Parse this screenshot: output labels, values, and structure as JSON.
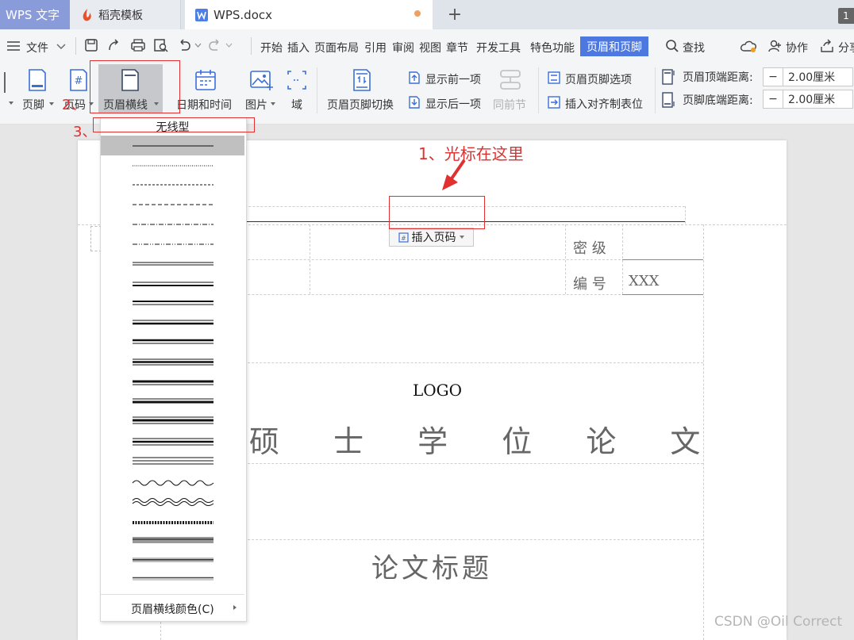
{
  "tabs": {
    "app": "WPS 文字",
    "template": "稻壳模板",
    "document": "WPS.docx",
    "add": "+",
    "count": "1"
  },
  "menu": {
    "file": "文件",
    "items": [
      "开始",
      "插入",
      "页面布局",
      "引用",
      "审阅",
      "视图",
      "章节",
      "开发工具",
      "特色功能"
    ],
    "active": "页眉和页脚",
    "search": "查找",
    "collab": "协作",
    "share": "分享"
  },
  "ribbon": {
    "footer": "页脚",
    "page_number": "页码",
    "header_line": "页眉横线",
    "date_time": "日期和时间",
    "picture": "图片",
    "field": "域",
    "switch": "页眉页脚切换",
    "show_prev": "显示前一项",
    "show_next": "显示后一项",
    "same_prev": "同前节",
    "options": "页眉页脚选项",
    "insert_tab": "插入对齐制表位",
    "header_top_label": "页眉顶端距离:",
    "header_top_value": "2.00厘米",
    "footer_bottom_label": "页脚底端距离:",
    "footer_bottom_value": "2.00厘米",
    "minus": "−"
  },
  "annotations": {
    "step1": "1、光标在这里",
    "step2": "2、",
    "step3": "3、"
  },
  "dropdown": {
    "none_option": "无线型",
    "color_option": "页眉横线颜色(C)"
  },
  "document": {
    "insert_page_number": "插入页码",
    "secret_label": "密 级",
    "number_label": "编 号",
    "number_value": "XXX",
    "logo": "LOGO",
    "degree_title": "硕 士 学 位 论 文",
    "thesis_title": "论文标题"
  },
  "watermark": "CSDN @Oil Correct",
  "colors": {
    "accent": "#4c78e0",
    "annotation": "#e03030"
  }
}
